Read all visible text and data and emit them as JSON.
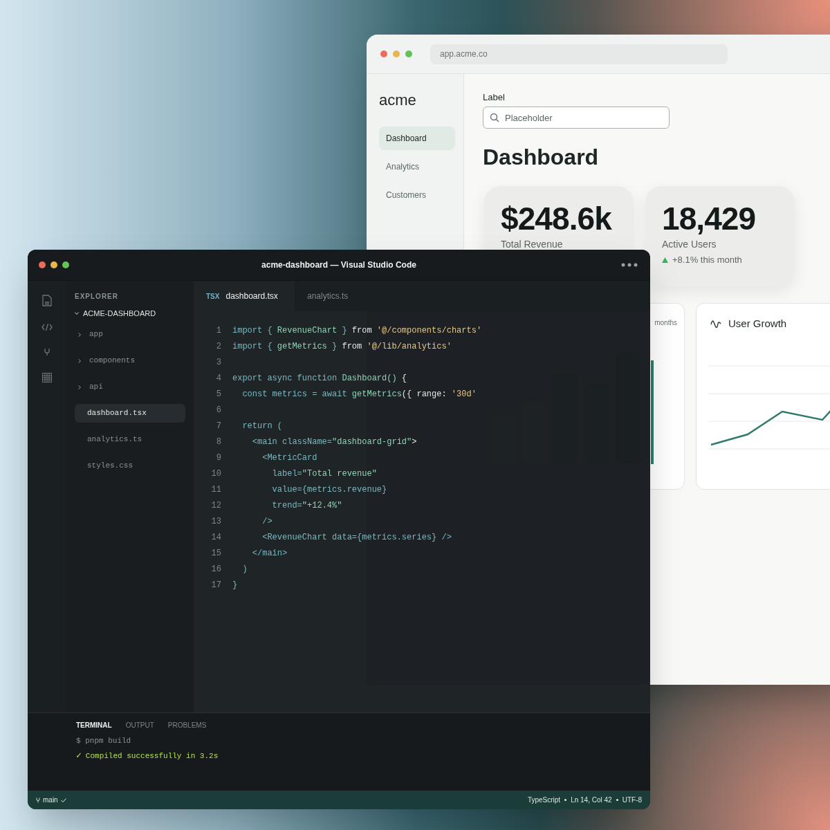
{
  "browser": {
    "url": "app.acme.co",
    "logo": "acme",
    "nav": [
      {
        "label": "Dashboard",
        "selected": true
      },
      {
        "label": "Analytics",
        "selected": false
      },
      {
        "label": "Customers",
        "selected": false
      }
    ],
    "search": {
      "label": "Label",
      "placeholder": "Placeholder"
    },
    "heading": "Dashboard",
    "metrics": [
      {
        "value": "$248.6k",
        "label": "Total Revenue"
      },
      {
        "value": "18,429",
        "label": "Active Users",
        "trend": "+8.1% this month"
      }
    ],
    "revenue_card": {
      "period": "months"
    },
    "growth_card": {
      "title": "User Growth"
    }
  },
  "editor": {
    "title": "acme-dashboard — Visual Studio Code",
    "explorer": {
      "title": "EXPLORER",
      "project": "ACME-DASHBOARD",
      "expanded": true,
      "children": [
        {
          "kind": "folder",
          "label": "app",
          "expanded": false,
          "selected": false
        },
        {
          "kind": "folder",
          "label": "components",
          "expanded": false,
          "selected": false
        },
        {
          "kind": "folder",
          "label": "api",
          "expanded": false,
          "selected": false
        },
        {
          "kind": "file",
          "label": "dashboard.tsx",
          "selected": true
        },
        {
          "kind": "file",
          "label": "analytics.ts",
          "selected": false
        },
        {
          "kind": "file",
          "label": "styles.css",
          "selected": false
        }
      ]
    },
    "tabs": [
      {
        "badge": "TSX",
        "label": "dashboard.tsx",
        "selected": true
      },
      {
        "label": "analytics.ts",
        "selected": false
      }
    ],
    "code": [
      {
        "n": "1",
        "tokens": [
          {
            "kind": "kw",
            "t": "import { "
          },
          {
            "kind": "name",
            "t": "RevenueChart"
          },
          {
            "kind": "kw",
            "t": " } "
          },
          {
            "kind": "plain",
            "t": "from "
          },
          {
            "kind": "str",
            "t": "'@/components/charts'"
          }
        ]
      },
      {
        "n": "2",
        "tokens": [
          {
            "kind": "kw",
            "t": "import { "
          },
          {
            "kind": "name",
            "t": "getMetrics"
          },
          {
            "kind": "kw",
            "t": " } "
          },
          {
            "kind": "plain",
            "t": "from "
          },
          {
            "kind": "str",
            "t": "'@/lib/analytics'"
          }
        ]
      },
      {
        "n": "3"
      },
      {
        "n": "4",
        "tokens": [
          {
            "kind": "kw",
            "t": "export async function "
          },
          {
            "kind": "name",
            "t": "Dashboard()"
          },
          {
            "kind": "plain",
            "t": " {"
          }
        ]
      },
      {
        "n": "5",
        "tokens": [
          {
            "kind": "kw",
            "t": "  const metrics = await "
          },
          {
            "kind": "name",
            "t": "getMetrics"
          },
          {
            "kind": "plain",
            "t": "({ range: "
          },
          {
            "kind": "str",
            "t": "'30d'"
          }
        ]
      },
      {
        "n": "6"
      },
      {
        "n": "7",
        "tokens": [
          {
            "kind": "kw",
            "t": "  return ("
          }
        ]
      },
      {
        "n": "8",
        "tokens": [
          {
            "kind": "kw",
            "t": "    <main className="
          },
          {
            "kind": "name",
            "t": "\"dashboard-grid\""
          },
          {
            "kind": "plain",
            "t": ">"
          }
        ]
      },
      {
        "n": "9",
        "tokens": [
          {
            "kind": "kw",
            "t": "      <MetricCard"
          }
        ]
      },
      {
        "n": "10",
        "tokens": [
          {
            "kind": "kw",
            "t": "        label="
          },
          {
            "kind": "name",
            "t": "\"Total revenue\""
          }
        ]
      },
      {
        "n": "11",
        "tokens": [
          {
            "kind": "kw",
            "t": "        value={metrics.revenue}"
          }
        ]
      },
      {
        "n": "12",
        "tokens": [
          {
            "kind": "kw",
            "t": "        trend="
          },
          {
            "kind": "name",
            "t": "\"+12.4%\""
          }
        ]
      },
      {
        "n": "13",
        "tokens": [
          {
            "kind": "kw",
            "t": "      />"
          }
        ]
      },
      {
        "n": "14",
        "tokens": [
          {
            "kind": "kw",
            "t": "      <RevenueChart data={metrics.series} />"
          }
        ]
      },
      {
        "n": "15",
        "tokens": [
          {
            "kind": "kw",
            "t": "    </main>"
          }
        ]
      },
      {
        "n": "16",
        "tokens": [
          {
            "kind": "kw",
            "t": "  )"
          }
        ]
      },
      {
        "n": "17",
        "tokens": [
          {
            "kind": "kw",
            "t": "}"
          }
        ]
      }
    ],
    "terminal": {
      "tabs": [
        {
          "label": "TERMINAL",
          "selected": true
        },
        {
          "label": "OUTPUT",
          "selected": false
        },
        {
          "label": "PROBLEMS",
          "selected": false
        }
      ],
      "lines": [
        {
          "kind": "command",
          "text": "$ pnpm build"
        },
        {
          "kind": "success",
          "mark": "✓",
          "text": "Compiled successfully in 3.2s"
        }
      ]
    },
    "status_bar": {
      "branch": "main",
      "items": [
        "TypeScript",
        "Ln 14, Col 42",
        "UTF-8"
      ]
    }
  }
}
